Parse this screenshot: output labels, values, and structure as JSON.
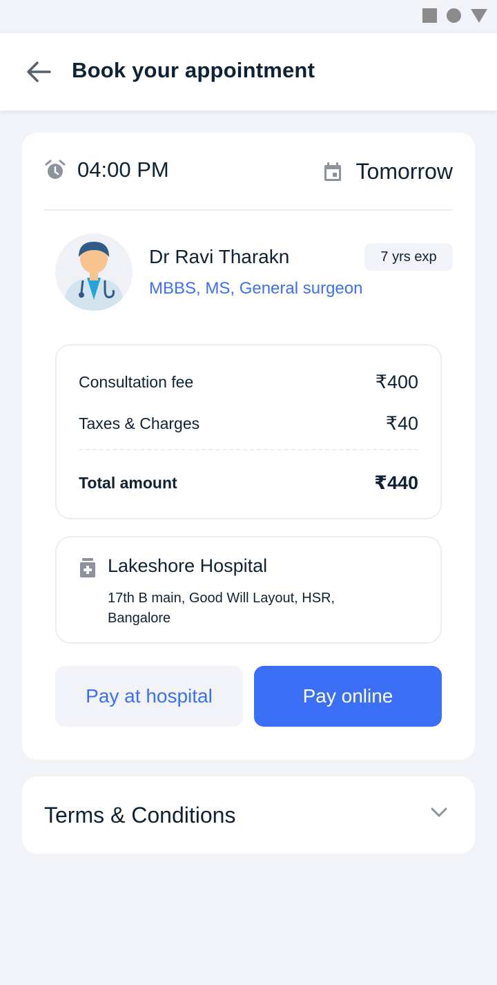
{
  "status_bar": {
    "icons": [
      "square-icon",
      "circle-icon",
      "triangle-icon"
    ]
  },
  "header": {
    "title": "Book your appointment",
    "back_icon": "arrow-left-icon"
  },
  "appointment": {
    "time": "04:00 PM",
    "date": "Tomorrow",
    "time_icon": "alarm-clock-icon",
    "date_icon": "calendar-icon"
  },
  "doctor": {
    "name": "Dr Ravi Tharakn",
    "qualification": "MBBS, MS, General surgeon",
    "experience": "7 yrs exp"
  },
  "fees": {
    "consultation_label": "Consultation fee",
    "consultation_value": "₹400",
    "taxes_label": "Taxes & Charges",
    "taxes_value": "₹40",
    "total_label": "Total amount",
    "total_value": "₹440"
  },
  "hospital": {
    "name": "Lakeshore Hospital",
    "address": "17th B main, Good Will Layout, HSR, Bangalore"
  },
  "actions": {
    "pay_hospital": "Pay at hospital",
    "pay_online": "Pay online"
  },
  "terms": {
    "label": "Terms & Conditions"
  },
  "colors": {
    "accent": "#3b6ff5",
    "background": "#f1f3f8",
    "text": "#0f2233"
  }
}
